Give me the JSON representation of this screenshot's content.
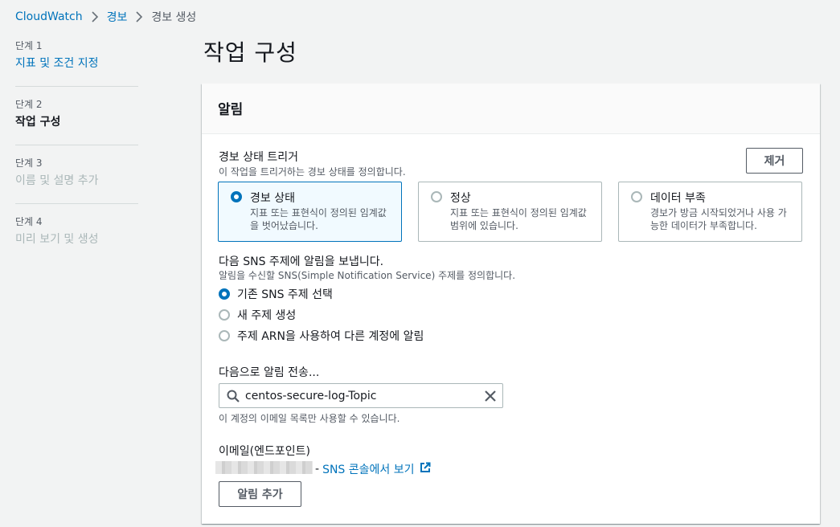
{
  "breadcrumb": {
    "items": [
      "CloudWatch",
      "경보"
    ],
    "current": "경보 생성"
  },
  "steps": [
    {
      "num": "단계 1",
      "label": "지표 및 조건 지정"
    },
    {
      "num": "단계 2",
      "label": "작업 구성"
    },
    {
      "num": "단계 3",
      "label": "이름 및 설명 추가"
    },
    {
      "num": "단계 4",
      "label": "미리 보기 및 생성"
    }
  ],
  "page_title": "작업 구성",
  "panel": {
    "title": "알림",
    "trigger": {
      "label": "경보 상태 트리거",
      "desc": "이 작업을 트리거하는 경보 상태를 정의합니다.",
      "remove_button": "제거",
      "options": [
        {
          "label": "경보 상태",
          "desc": "지표 또는 표현식이 정의된 임계값을 벗어났습니다.",
          "selected": true
        },
        {
          "label": "정상",
          "desc": "지표 또는 표현식이 정의된 임계값 범위에 있습니다.",
          "selected": false
        },
        {
          "label": "데이터 부족",
          "desc": "경보가 방금 시작되었거나 사용 가능한 데이터가 부족합니다.",
          "selected": false
        }
      ]
    },
    "sns": {
      "label": "다음 SNS 주제에 알림을 보냅니다.",
      "desc": "알림을 수신할 SNS(Simple Notification Service) 주제를 정의합니다.",
      "options": [
        {
          "label": "기존 SNS 주제 선택",
          "selected": true
        },
        {
          "label": "새 주제 생성",
          "selected": false
        },
        {
          "label": "주제 ARN을 사용하여 다른 계정에 알림",
          "selected": false
        }
      ]
    },
    "send_to": {
      "label": "다음으로 알림 전송...",
      "value": "centos-secure-log-Topic",
      "hint": "이 계정의 이메일 목록만 사용할 수 있습니다."
    },
    "email": {
      "label": "이메일(엔드포인트)",
      "link": "SNS 콘솔에서 보기"
    },
    "add_button": "알림 추가"
  },
  "colors": {
    "accent": "#0073bb",
    "text": "#16191f",
    "muted": "#545b64",
    "background": "#f2f3f3"
  }
}
